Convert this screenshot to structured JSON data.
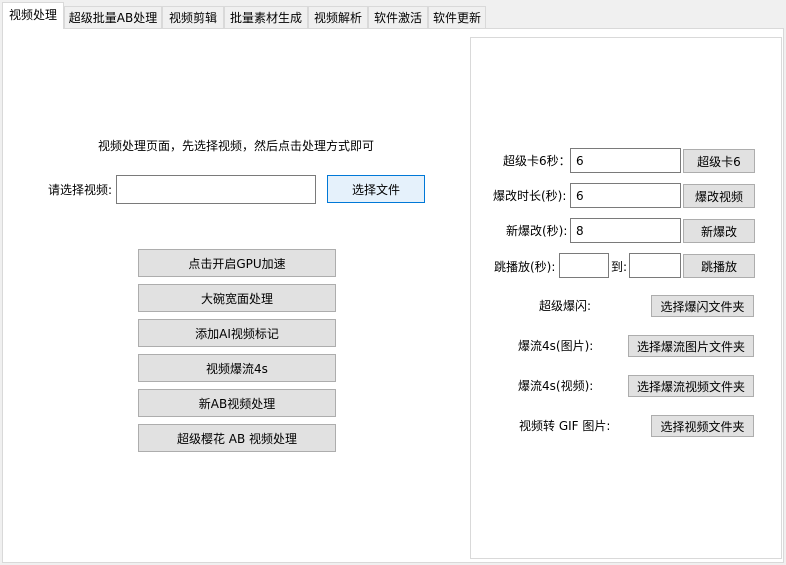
{
  "tabs": [
    "视频处理",
    "超级批量AB处理",
    "视频剪辑",
    "批量素材生成",
    "视频解析",
    "软件激活",
    "软件更新"
  ],
  "left": {
    "hint": "视频处理页面，先选择视频，然后点击处理方式即可",
    "select_label": "请选择视频:",
    "select_value": "",
    "select_button": "选择文件",
    "actions": [
      "点击开启GPU加速",
      "大碗宽面处理",
      "添加AI视频标记",
      "视频爆流4s",
      "新AB视频处理",
      "超级樱花 AB 视频处理"
    ]
  },
  "right": {
    "super_card_label": "超级卡6秒：",
    "super_card_value": "6",
    "super_card_button": "超级卡6",
    "burst_duration_label": "爆改时长(秒):",
    "burst_duration_value": "6",
    "burst_duration_button": "爆改视频",
    "new_burst_label": "新爆改(秒):",
    "new_burst_value": "8",
    "new_burst_button": "新爆改",
    "skip_label": "跳播放(秒):",
    "skip_from": "",
    "skip_to_label": "到:",
    "skip_to": "",
    "skip_button": "跳播放",
    "flash_label": "超级爆闪:",
    "flash_button": "选择爆闪文件夹",
    "stream_image_label": "爆流4s(图片):",
    "stream_image_button": "选择爆流图片文件夹",
    "stream_video_label": "爆流4s(视频):",
    "stream_video_button": "选择爆流视频文件夹",
    "gif_label": "视频转 GIF 图片:",
    "gif_button": "选择视频文件夹"
  }
}
